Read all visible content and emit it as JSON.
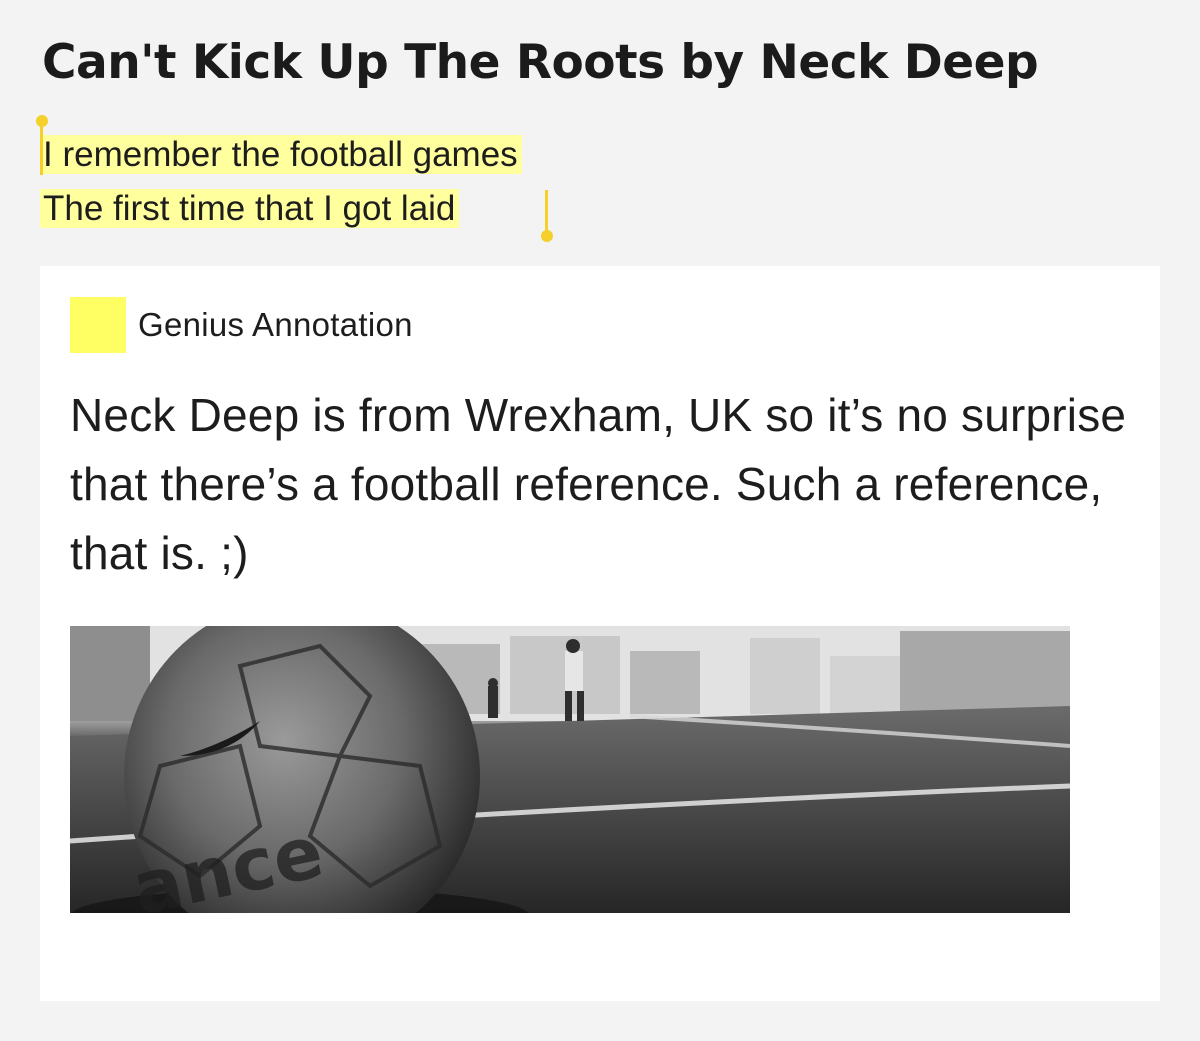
{
  "page": {
    "title": "Can't Kick Up The Roots by Neck Deep"
  },
  "lyrics": {
    "lines": [
      "I remember the football games",
      "The first time that I got laid"
    ]
  },
  "annotation": {
    "label": "Genius Annotation",
    "body": "Neck Deep is from Wrexham, UK so it’s no surprise that there’s a football reference. Such a reference, that is. ;)",
    "swatch_color": "#ffff64",
    "highlight_color": "#ffff9e",
    "caret_color": "#f5cf2a",
    "image": "soccer-ball-photo",
    "image_alt_text": "ance"
  }
}
